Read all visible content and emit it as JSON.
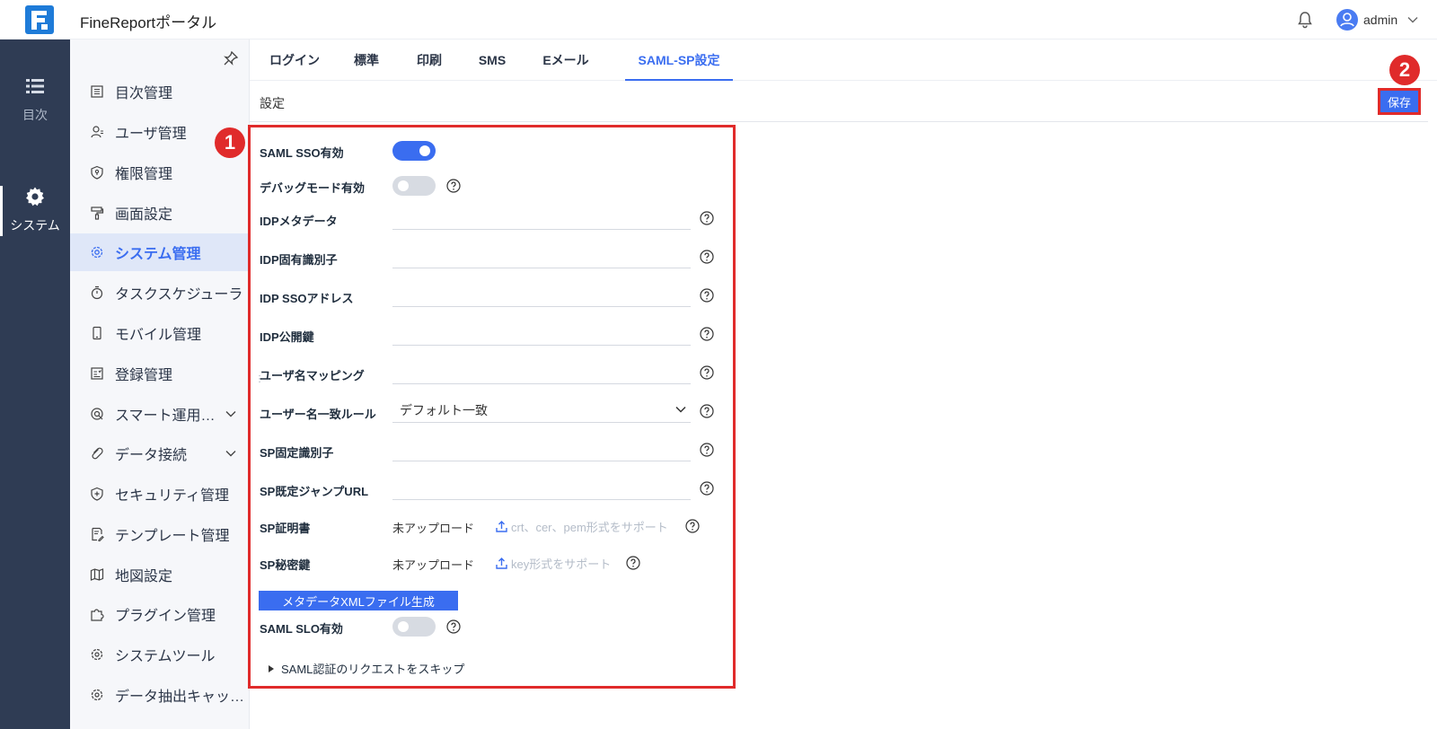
{
  "app": {
    "title": "FineReportポータル",
    "user": "admin"
  },
  "rail": [
    {
      "label": "目次",
      "icon": "list-icon"
    },
    {
      "label": "システム",
      "icon": "gear-icon"
    }
  ],
  "sidebar": {
    "items": [
      {
        "label": "目次管理",
        "icon": "catalog-icon"
      },
      {
        "label": "ユーザ管理",
        "icon": "user-icon"
      },
      {
        "label": "権限管理",
        "icon": "shield-icon"
      },
      {
        "label": "画面設定",
        "icon": "brush-icon"
      },
      {
        "label": "システム管理",
        "icon": "gear-icon",
        "active": true
      },
      {
        "label": "タスクスケジューラ",
        "icon": "timer-icon"
      },
      {
        "label": "モバイル管理",
        "icon": "mobile-icon"
      },
      {
        "label": "登録管理",
        "icon": "register-icon"
      },
      {
        "label": "スマート運用…",
        "icon": "smart-icon",
        "expandable": true
      },
      {
        "label": "データ接続",
        "icon": "link-icon",
        "expandable": true
      },
      {
        "label": "セキュリティ管理",
        "icon": "security-icon"
      },
      {
        "label": "テンプレート管理",
        "icon": "template-icon"
      },
      {
        "label": "地図設定",
        "icon": "map-icon"
      },
      {
        "label": "プラグイン管理",
        "icon": "plugin-icon"
      },
      {
        "label": "システムツール",
        "icon": "tool-icon"
      },
      {
        "label": "データ抽出キャッ…",
        "icon": "extract-icon"
      }
    ]
  },
  "tabs": [
    "ログイン",
    "標準",
    "印刷",
    "SMS",
    "Eメール",
    "SAML-SP設定"
  ],
  "active_tab": "SAML-SP設定",
  "section": {
    "title": "設定",
    "save_label": "保存"
  },
  "badges": [
    "1",
    "2"
  ],
  "form": {
    "saml_sso": {
      "label": "SAML SSO有効",
      "enabled": true
    },
    "debug": {
      "label": "デバッグモード有効",
      "enabled": false
    },
    "idp_metadata": {
      "label": "IDPメタデータ",
      "value": ""
    },
    "idp_entity_id": {
      "label": "IDP固有識別子",
      "value": ""
    },
    "idp_sso_address": {
      "label": "IDP SSOアドレス",
      "value": ""
    },
    "idp_public_key": {
      "label": "IDP公開鍵",
      "value": ""
    },
    "username_mapping": {
      "label": "ユーザ名マッピング",
      "value": ""
    },
    "username_match_rule": {
      "label": "ユーザー名一致ルール",
      "value": "デフォルト一致"
    },
    "sp_entity_id": {
      "label": "SP固定識別子",
      "value": ""
    },
    "sp_default_jump_url": {
      "label": "SP既定ジャンプURL",
      "value": ""
    },
    "sp_certificate": {
      "label": "SP証明書",
      "status": "未アップロード",
      "hint": "crt、cer、pem形式をサポート"
    },
    "sp_private_key": {
      "label": "SP秘密鍵",
      "status": "未アップロード",
      "hint": "key形式をサポート"
    },
    "generate_button": "メタデータXMLファイル生成",
    "saml_slo": {
      "label": "SAML SLO有効",
      "enabled": false
    },
    "skip_request": "SAML認証のリクエストをスキップ"
  },
  "colors": {
    "primary": "#3a6df0",
    "rail_bg": "#2f3c54",
    "highlight": "#e02b2b"
  }
}
